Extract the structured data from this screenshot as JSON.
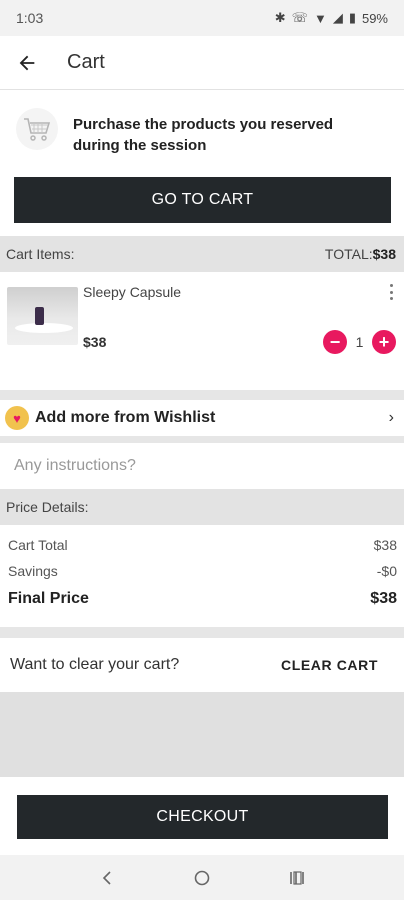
{
  "status": {
    "time": "1:03",
    "battery": "59%"
  },
  "appbar": {
    "title": "Cart"
  },
  "promo": {
    "message": "Purchase the products you reserved during the session",
    "button": "GO TO CART"
  },
  "cart": {
    "items_label": "Cart Items:",
    "total_label": "TOTAL:",
    "total_value": "$38",
    "items": [
      {
        "name": "Sleepy Capsule",
        "price": "$38",
        "quantity": "1"
      }
    ]
  },
  "wishlist": {
    "label": "Add more from Wishlist"
  },
  "instructions": {
    "placeholder": "Any instructions?"
  },
  "price_details": {
    "header": "Price Details:",
    "cart_total_label": "Cart Total",
    "cart_total_value": "$38",
    "savings_label": "Savings",
    "savings_value": "-$0",
    "final_label": "Final Price",
    "final_value": "$38"
  },
  "clear": {
    "question": "Want to clear your cart?",
    "button": "CLEAR CART"
  },
  "checkout": {
    "button": "CHECKOUT"
  },
  "colors": {
    "accent": "#e8195f",
    "dark_button": "#23282b",
    "heart_bg": "#f1c24e"
  },
  "icons": [
    "back-arrow-icon",
    "cart-icon",
    "more-vert-icon",
    "minus-icon",
    "plus-icon",
    "heart-icon",
    "chevron-right-icon",
    "nav-back-icon",
    "nav-home-icon",
    "nav-recents-icon"
  ]
}
